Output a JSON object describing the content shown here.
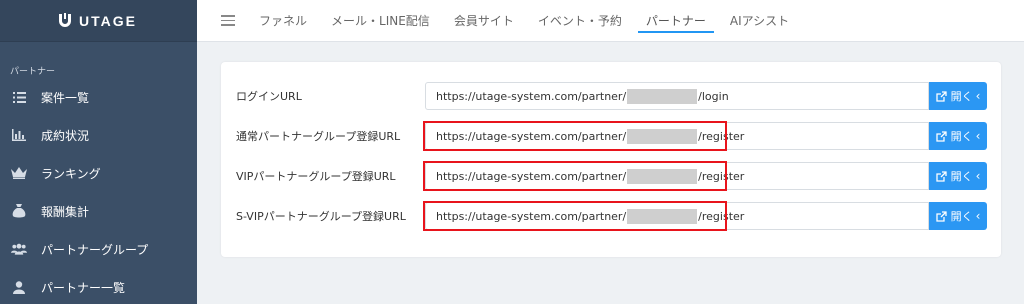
{
  "app": {
    "logo_text": "UTAGE"
  },
  "sidebar": {
    "section": "パートナー",
    "items": [
      {
        "label": "案件一覧",
        "icon": "list-icon"
      },
      {
        "label": "成約状況",
        "icon": "bar-chart-icon"
      },
      {
        "label": "ランキング",
        "icon": "crown-icon"
      },
      {
        "label": "報酬集計",
        "icon": "money-bag-icon"
      },
      {
        "label": "パートナーグループ",
        "icon": "users-icon"
      },
      {
        "label": "パートナー一覧",
        "icon": "user-icon"
      }
    ]
  },
  "topnav": {
    "tabs": [
      {
        "label": "ファネル",
        "active": false
      },
      {
        "label": "メール・LINE配信",
        "active": false
      },
      {
        "label": "会員サイト",
        "active": false
      },
      {
        "label": "イベント・予約",
        "active": false
      },
      {
        "label": "パートナー",
        "active": true
      },
      {
        "label": "AIアシスト",
        "active": false
      }
    ]
  },
  "main": {
    "open_label": "開く",
    "rows": [
      {
        "label": "ログインURL",
        "url_prefix": "https://utage-system.com/partner/",
        "url_suffix": "/login",
        "highlighted": false
      },
      {
        "label": "通常パートナーグループ登録URL",
        "url_prefix": "https://utage-system.com/partner/",
        "url_suffix": "/register",
        "highlighted": true
      },
      {
        "label": "VIPパートナーグループ登録URL",
        "url_prefix": "https://utage-system.com/partner/",
        "url_suffix": "/register",
        "highlighted": true
      },
      {
        "label": "S-VIPパートナーグループ登録URL",
        "url_prefix": "https://utage-system.com/partner/",
        "url_suffix": "/register",
        "highlighted": true
      }
    ]
  },
  "colors": {
    "sidebar_bg": "#3b4f67",
    "accent": "#2b97f3",
    "highlight": "#e8141c"
  }
}
